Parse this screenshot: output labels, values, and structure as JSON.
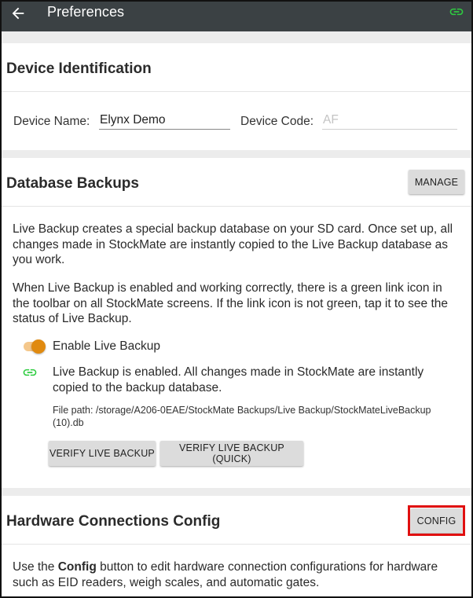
{
  "toolbar": {
    "title": "Preferences",
    "back_icon": "arrow-left-icon",
    "link_icon": "link-icon",
    "link_color": "#2ecc40"
  },
  "device_identification": {
    "title": "Device Identification",
    "device_name_label": "Device Name:",
    "device_name_value": "Elynx Demo",
    "device_code_label": "Device Code:",
    "device_code_value": "AF"
  },
  "database_backups": {
    "title": "Database Backups",
    "manage_label": "MANAGE",
    "paragraph1": "Live Backup creates a special backup database on your SD card. Once set up, all changes made in StockMate are instantly copied to the Live Backup database as you work.",
    "paragraph2": "When Live Backup is enabled and working correctly, there is a green link icon in the toolbar on all StockMate screens. If the link icon is not green, tap it to see the status of Live Backup.",
    "toggle_label": "Enable Live Backup",
    "toggle_on": true,
    "toggle_color": "#e08a10",
    "status_text": "Live Backup is enabled. All changes made in StockMate are instantly copied to the backup database.",
    "file_path": "File path: /storage/A206-0EAE/StockMate Backups/Live Backup/StockMateLiveBackup (10).db",
    "verify_label": "VERIFY LIVE BACKUP",
    "verify_quick_label": "VERIFY LIVE BACKUP (QUICK)"
  },
  "hardware": {
    "title": "Hardware Connections Config",
    "config_label": "CONFIG",
    "description_pre": "Use the ",
    "description_bold": "Config",
    "description_post": " button to edit hardware connection configurations for hardware such as EID readers, weigh scales, and automatic gates.",
    "highlight_color": "#e01010"
  }
}
